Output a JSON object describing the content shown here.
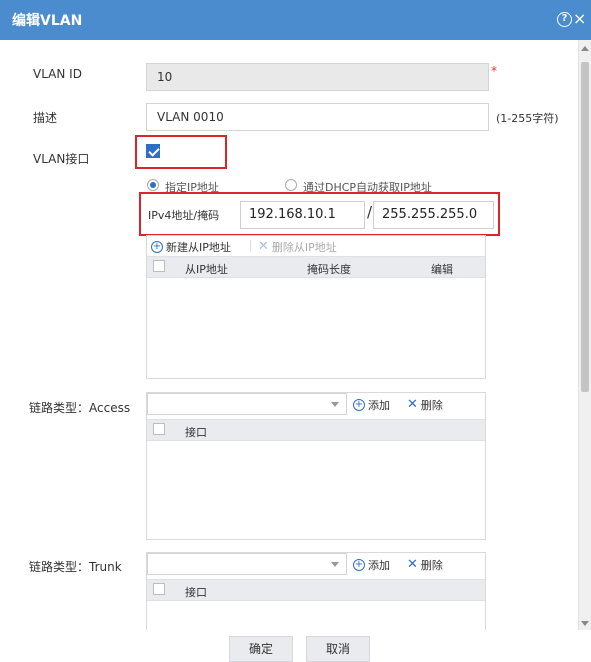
{
  "dialog": {
    "title": "编辑VLAN",
    "help_icon": "?",
    "close_icon": "×"
  },
  "form": {
    "vlan_id_label": "VLAN ID",
    "vlan_id_value": "10",
    "required_mark": "*",
    "desc_label": "描述",
    "desc_value": "VLAN 0010",
    "desc_hint": "(1-255字符)",
    "vlan_if_label": "VLAN接口",
    "vlan_if_checked": true
  },
  "ip_config": {
    "radio_static": "指定IP地址",
    "radio_dhcp": "通过DHCP自动获取IP地址",
    "ipv4_label": "IPv4地址/掩码",
    "ip_value": "192.168.10.1",
    "separator": "/",
    "mask_value": "255.255.255.0"
  },
  "secondary_ip": {
    "add_label": "新建从IP地址",
    "delete_label": "删除从IP地址",
    "columns": [
      "从IP地址",
      "掩码长度",
      "编辑"
    ]
  },
  "access": {
    "label": "链路类型：Access",
    "add_label": "添加",
    "delete_label": "删除",
    "column": "接口"
  },
  "trunk": {
    "label": "链路类型：Trunk",
    "add_label": "添加",
    "delete_label": "删除",
    "column": "接口"
  },
  "footer": {
    "ok_label": "确定",
    "cancel_label": "取消"
  },
  "colors": {
    "titlebar": "#4a8ccd",
    "accent": "#2d6fc4",
    "highlight": "#d9262a"
  }
}
